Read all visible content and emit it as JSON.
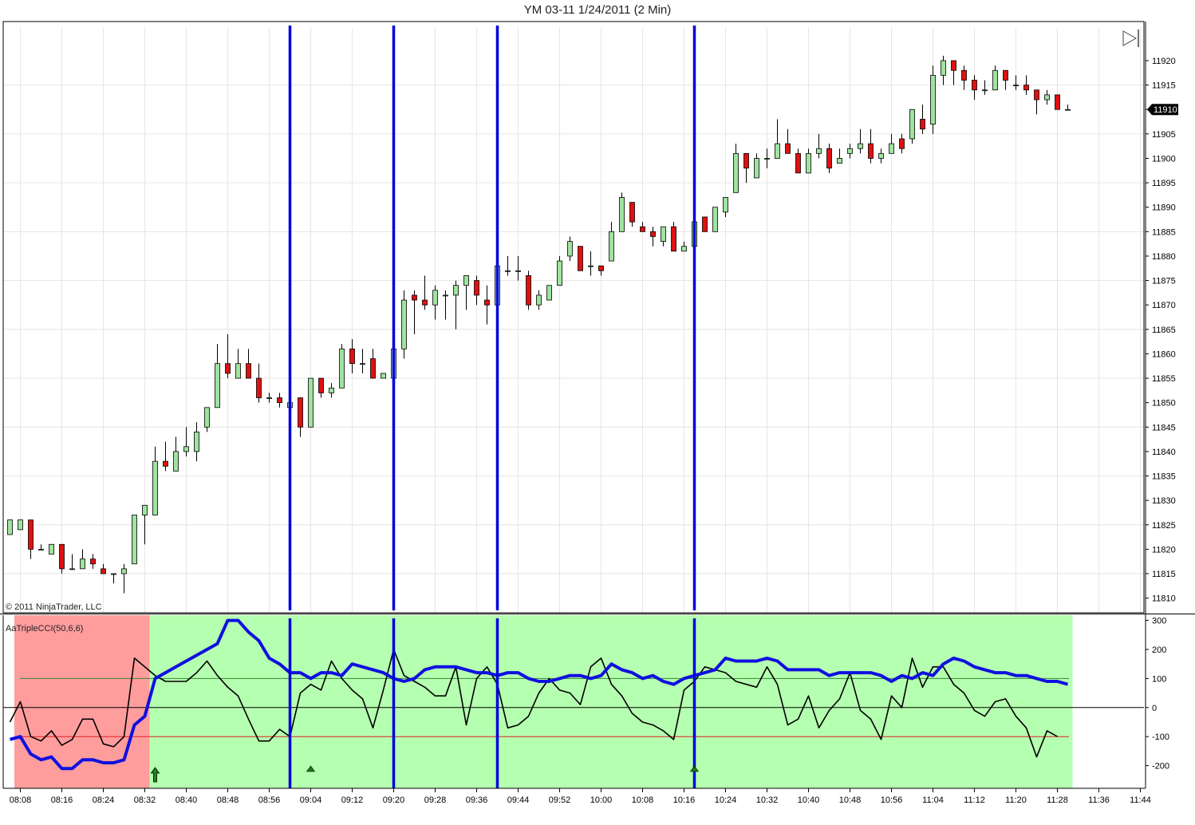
{
  "window": {
    "title": "YM 03-11  1/24/2011 (2 Min)"
  },
  "copyright": "© 2011 NinjaTrader, LLC",
  "indicator_label": "AaTripleCCI(50,6,6)",
  "price_marker": "11910",
  "colors": {
    "up_candle": "#9fe39f",
    "down_candle": "#e01010",
    "vertical_lines": "#0000dd",
    "cci_fast": "#000000",
    "cci_slow": "#1010e0",
    "bg_bull": "#b5ffb0",
    "bg_bear": "#ff9d9d",
    "level_100": "#338833",
    "level_0": "#000000",
    "level_minus100": "#dd2222"
  },
  "chart_data": [
    {
      "type": "candlestick",
      "title": "YM 03-11  1/24/2011 (2 Min)",
      "time_labels": [
        "08:08",
        "08:16",
        "08:24",
        "08:32",
        "08:40",
        "08:48",
        "08:56",
        "09:04",
        "09:12",
        "09:20",
        "09:28",
        "09:36",
        "09:44",
        "09:52",
        "10:00",
        "10:08",
        "10:16",
        "10:24",
        "10:32",
        "10:40",
        "10:48",
        "10:56",
        "11:04",
        "11:12",
        "11:20",
        "11:28",
        "11:36",
        "11:44"
      ],
      "y_ticks": [
        11810,
        11815,
        11820,
        11825,
        11830,
        11835,
        11840,
        11845,
        11850,
        11855,
        11860,
        11865,
        11870,
        11875,
        11880,
        11885,
        11890,
        11895,
        11900,
        11905,
        11910,
        11915,
        11920
      ],
      "ylim": [
        11807,
        11928
      ],
      "start_time": "08:06",
      "bar_minutes": 2,
      "candles": [
        {
          "o": 11823,
          "h": 11826,
          "l": 11823,
          "c": 11826
        },
        {
          "o": 11824,
          "h": 11826,
          "l": 11824,
          "c": 11826
        },
        {
          "o": 11826,
          "h": 11826,
          "l": 11818,
          "c": 11820
        },
        {
          "o": 11820,
          "h": 11821,
          "l": 11820,
          "c": 11820
        },
        {
          "o": 11819,
          "h": 11821,
          "l": 11819,
          "c": 11821
        },
        {
          "o": 11821,
          "h": 11821,
          "l": 11815,
          "c": 11816
        },
        {
          "o": 11816,
          "h": 11819,
          "l": 11816,
          "c": 11816
        },
        {
          "o": 11816,
          "h": 11820,
          "l": 11816,
          "c": 11818
        },
        {
          "o": 11818,
          "h": 11819,
          "l": 11816,
          "c": 11817
        },
        {
          "o": 11816,
          "h": 11817,
          "l": 11815,
          "c": 11815
        },
        {
          "o": 11815,
          "h": 11815,
          "l": 11813,
          "c": 11815
        },
        {
          "o": 11815,
          "h": 11817,
          "l": 11811,
          "c": 11816
        },
        {
          "o": 11817,
          "h": 11827,
          "l": 11817,
          "c": 11827
        },
        {
          "o": 11827,
          "h": 11829,
          "l": 11821,
          "c": 11829
        },
        {
          "o": 11827,
          "h": 11841,
          "l": 11827,
          "c": 11838
        },
        {
          "o": 11838,
          "h": 11842,
          "l": 11836,
          "c": 11837
        },
        {
          "o": 11836,
          "h": 11843,
          "l": 11836,
          "c": 11840
        },
        {
          "o": 11840,
          "h": 11845,
          "l": 11839,
          "c": 11841
        },
        {
          "o": 11840,
          "h": 11846,
          "l": 11838,
          "c": 11844
        },
        {
          "o": 11845,
          "h": 11849,
          "l": 11844,
          "c": 11849
        },
        {
          "o": 11849,
          "h": 11862,
          "l": 11849,
          "c": 11858
        },
        {
          "o": 11858,
          "h": 11864,
          "l": 11855,
          "c": 11856
        },
        {
          "o": 11855,
          "h": 11861,
          "l": 11855,
          "c": 11858
        },
        {
          "o": 11858,
          "h": 11861,
          "l": 11855,
          "c": 11855
        },
        {
          "o": 11855,
          "h": 11858,
          "l": 11850,
          "c": 11851
        },
        {
          "o": 11851,
          "h": 11852,
          "l": 11850,
          "c": 11851
        },
        {
          "o": 11851,
          "h": 11852,
          "l": 11849,
          "c": 11850
        },
        {
          "o": 11849,
          "h": 11851,
          "l": 11848,
          "c": 11850
        },
        {
          "o": 11851,
          "h": 11851,
          "l": 11843,
          "c": 11845
        },
        {
          "o": 11845,
          "h": 11855,
          "l": 11845,
          "c": 11855
        },
        {
          "o": 11855,
          "h": 11855,
          "l": 11851,
          "c": 11852
        },
        {
          "o": 11852,
          "h": 11854,
          "l": 11851,
          "c": 11853
        },
        {
          "o": 11853,
          "h": 11862,
          "l": 11853,
          "c": 11861
        },
        {
          "o": 11861,
          "h": 11863,
          "l": 11856,
          "c": 11858
        },
        {
          "o": 11858,
          "h": 11861,
          "l": 11856,
          "c": 11858
        },
        {
          "o": 11859,
          "h": 11861,
          "l": 11855,
          "c": 11855
        },
        {
          "o": 11855,
          "h": 11856,
          "l": 11855,
          "c": 11856
        },
        {
          "o": 11855,
          "h": 11862,
          "l": 11853,
          "c": 11861
        },
        {
          "o": 11861,
          "h": 11873,
          "l": 11859,
          "c": 11871
        },
        {
          "o": 11872,
          "h": 11873,
          "l": 11864,
          "c": 11871
        },
        {
          "o": 11871,
          "h": 11876,
          "l": 11869,
          "c": 11870
        },
        {
          "o": 11870,
          "h": 11874,
          "l": 11867,
          "c": 11873
        },
        {
          "o": 11872,
          "h": 11873,
          "l": 11867,
          "c": 11872
        },
        {
          "o": 11872,
          "h": 11875,
          "l": 11865,
          "c": 11874
        },
        {
          "o": 11874,
          "h": 11876,
          "l": 11869,
          "c": 11876
        },
        {
          "o": 11875,
          "h": 11876,
          "l": 11870,
          "c": 11872
        },
        {
          "o": 11871,
          "h": 11874,
          "l": 11866,
          "c": 11870
        },
        {
          "o": 11870,
          "h": 11879,
          "l": 11870,
          "c": 11878
        },
        {
          "o": 11877,
          "h": 11880,
          "l": 11876,
          "c": 11877
        },
        {
          "o": 11877,
          "h": 11880,
          "l": 11875,
          "c": 11877
        },
        {
          "o": 11876,
          "h": 11877,
          "l": 11869,
          "c": 11870
        },
        {
          "o": 11870,
          "h": 11873,
          "l": 11869,
          "c": 11872
        },
        {
          "o": 11871,
          "h": 11874,
          "l": 11871,
          "c": 11874
        },
        {
          "o": 11874,
          "h": 11880,
          "l": 11874,
          "c": 11879
        },
        {
          "o": 11880,
          "h": 11884,
          "l": 11879,
          "c": 11883
        },
        {
          "o": 11882,
          "h": 11882,
          "l": 11877,
          "c": 11877
        },
        {
          "o": 11878,
          "h": 11881,
          "l": 11876,
          "c": 11878
        },
        {
          "o": 11878,
          "h": 11878,
          "l": 11876,
          "c": 11877
        },
        {
          "o": 11879,
          "h": 11887,
          "l": 11879,
          "c": 11885
        },
        {
          "o": 11885,
          "h": 11893,
          "l": 11885,
          "c": 11892
        },
        {
          "o": 11891,
          "h": 11891,
          "l": 11886,
          "c": 11887
        },
        {
          "o": 11886,
          "h": 11887,
          "l": 11885,
          "c": 11885
        },
        {
          "o": 11885,
          "h": 11886,
          "l": 11882,
          "c": 11884
        },
        {
          "o": 11883,
          "h": 11886,
          "l": 11882,
          "c": 11886
        },
        {
          "o": 11886,
          "h": 11887,
          "l": 11881,
          "c": 11881
        },
        {
          "o": 11881,
          "h": 11883,
          "l": 11881,
          "c": 11882
        },
        {
          "o": 11882,
          "h": 11888,
          "l": 11880,
          "c": 11887
        },
        {
          "o": 11888,
          "h": 11888,
          "l": 11885,
          "c": 11885
        },
        {
          "o": 11885,
          "h": 11890,
          "l": 11885,
          "c": 11890
        },
        {
          "o": 11889,
          "h": 11892,
          "l": 11888,
          "c": 11892
        },
        {
          "o": 11893,
          "h": 11903,
          "l": 11893,
          "c": 11901
        },
        {
          "o": 11901,
          "h": 11901,
          "l": 11895,
          "c": 11898
        },
        {
          "o": 11896,
          "h": 11901,
          "l": 11896,
          "c": 11900
        },
        {
          "o": 11900,
          "h": 11902,
          "l": 11898,
          "c": 11900
        },
        {
          "o": 11900,
          "h": 11908,
          "l": 11900,
          "c": 11903
        },
        {
          "o": 11903,
          "h": 11906,
          "l": 11901,
          "c": 11901
        },
        {
          "o": 11901,
          "h": 11902,
          "l": 11897,
          "c": 11897
        },
        {
          "o": 11897,
          "h": 11902,
          "l": 11897,
          "c": 11901
        },
        {
          "o": 11901,
          "h": 11905,
          "l": 11900,
          "c": 11902
        },
        {
          "o": 11902,
          "h": 11903,
          "l": 11897,
          "c": 11898
        },
        {
          "o": 11899,
          "h": 11902,
          "l": 11899,
          "c": 11900
        },
        {
          "o": 11901,
          "h": 11903,
          "l": 11900,
          "c": 11902
        },
        {
          "o": 11902,
          "h": 11906,
          "l": 11901,
          "c": 11903
        },
        {
          "o": 11903,
          "h": 11906,
          "l": 11899,
          "c": 11900
        },
        {
          "o": 11900,
          "h": 11902,
          "l": 11899,
          "c": 11901
        },
        {
          "o": 11901,
          "h": 11905,
          "l": 11901,
          "c": 11903
        },
        {
          "o": 11904,
          "h": 11905,
          "l": 11901,
          "c": 11902
        },
        {
          "o": 11904,
          "h": 11910,
          "l": 11903,
          "c": 11910
        },
        {
          "o": 11908,
          "h": 11911,
          "l": 11905,
          "c": 11906
        },
        {
          "o": 11907,
          "h": 11919,
          "l": 11905,
          "c": 11917
        },
        {
          "o": 11917,
          "h": 11921,
          "l": 11915,
          "c": 11920
        },
        {
          "o": 11920,
          "h": 11920,
          "l": 11915,
          "c": 11918
        },
        {
          "o": 11918,
          "h": 11919,
          "l": 11914,
          "c": 11916
        },
        {
          "o": 11916,
          "h": 11917,
          "l": 11912,
          "c": 11914
        },
        {
          "o": 11914,
          "h": 11916,
          "l": 11913,
          "c": 11914
        },
        {
          "o": 11914,
          "h": 11919,
          "l": 11914,
          "c": 11918
        },
        {
          "o": 11918,
          "h": 11918,
          "l": 11914,
          "c": 11916
        },
        {
          "o": 11915,
          "h": 11917,
          "l": 11914,
          "c": 11915
        },
        {
          "o": 11915,
          "h": 11917,
          "l": 11913,
          "c": 11914
        },
        {
          "o": 11914,
          "h": 11914,
          "l": 11909,
          "c": 11912
        },
        {
          "o": 11912,
          "h": 11914,
          "l": 11911,
          "c": 11913
        },
        {
          "o": 11913,
          "h": 11913,
          "l": 11910,
          "c": 11910
        },
        {
          "o": 11910,
          "h": 11911,
          "l": 11910,
          "c": 11910
        }
      ],
      "vertical_line_times": [
        "09:00",
        "09:20",
        "09:40",
        "10:18"
      ]
    },
    {
      "type": "line",
      "label": "AaTripleCCI(50,6,6)",
      "y_ticks": [
        300,
        200,
        100,
        0,
        -100,
        -200
      ],
      "ylim": [
        -278,
        318
      ],
      "levels": [
        100,
        0,
        -100
      ],
      "series": [
        {
          "values": [
            -50,
            20,
            -100,
            -115,
            -80,
            -130,
            -110,
            -40,
            -40,
            -125,
            -135,
            -100,
            170,
            140,
            110,
            90,
            90,
            90,
            120,
            160,
            110,
            70,
            40,
            -40,
            -115,
            -115,
            -75,
            -100,
            50,
            80,
            60,
            160,
            100,
            60,
            30,
            -70,
            60,
            200,
            110,
            90,
            70,
            40,
            40,
            140,
            -60,
            100,
            140,
            80,
            -70,
            -60,
            -30,
            50,
            100,
            60,
            50,
            10,
            140,
            170,
            80,
            40,
            -20,
            -50,
            -60,
            -80,
            -110,
            60,
            90,
            140,
            130,
            120,
            90,
            80,
            70,
            140,
            80,
            -60,
            -40,
            40,
            -70,
            -10,
            30,
            120,
            -10,
            -40,
            -110,
            40,
            0,
            170,
            70,
            140,
            140,
            80,
            50,
            -10,
            -30,
            20,
            30,
            -30,
            -70,
            -170,
            -80,
            -100
          ]
        },
        {
          "values": [
            -110,
            -100,
            -160,
            -180,
            -170,
            -210,
            -210,
            -180,
            -180,
            -190,
            -190,
            -180,
            -60,
            -30,
            100,
            120,
            140,
            160,
            180,
            200,
            220,
            300,
            300,
            260,
            230,
            170,
            150,
            120,
            120,
            100,
            120,
            120,
            110,
            150,
            140,
            130,
            120,
            100,
            90,
            100,
            130,
            140,
            140,
            140,
            130,
            120,
            120,
            110,
            120,
            120,
            100,
            90,
            90,
            100,
            110,
            110,
            100,
            110,
            150,
            130,
            120,
            100,
            110,
            90,
            80,
            100,
            110,
            120,
            130,
            170,
            160,
            160,
            160,
            170,
            160,
            130,
            130,
            130,
            130,
            110,
            120,
            120,
            120,
            120,
            110,
            90,
            110,
            100,
            120,
            110,
            150,
            170,
            160,
            140,
            130,
            120,
            120,
            110,
            110,
            100,
            90,
            90,
            80
          ]
        }
      ],
      "bg_regions": [
        {
          "from_bar": 0,
          "to_bar": 14,
          "state": "bear"
        },
        {
          "from_bar": 14,
          "to_bar": 103,
          "state": "bull"
        }
      ],
      "arrows": [
        {
          "bar": 14,
          "kind": "up-arrow"
        },
        {
          "bar": 29,
          "kind": "up-triangle"
        },
        {
          "bar": 66,
          "kind": "up-triangle"
        }
      ]
    }
  ]
}
